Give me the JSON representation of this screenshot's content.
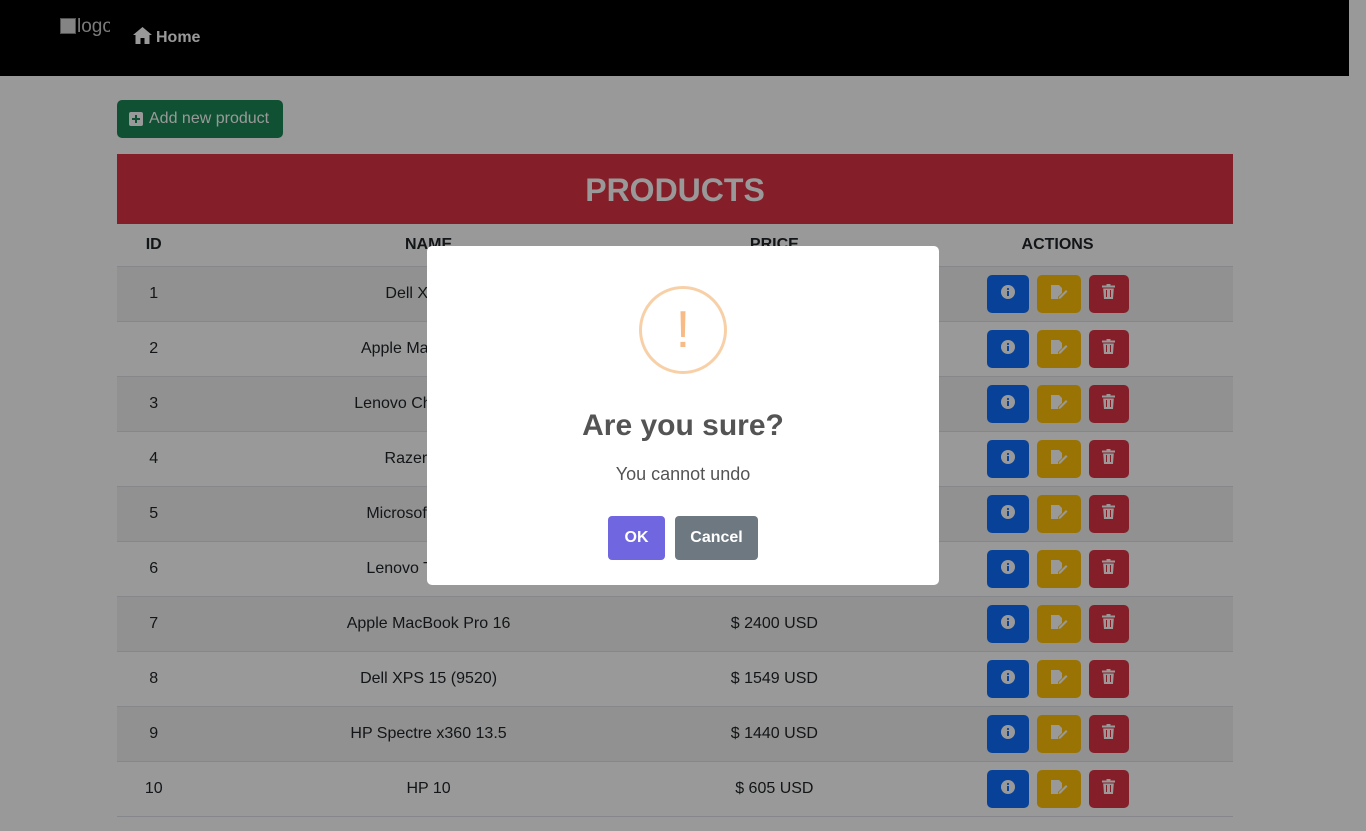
{
  "navbar": {
    "logo_alt": "logo",
    "home_label": "Home"
  },
  "toolbar": {
    "add_label": "Add new product"
  },
  "banner": {
    "title": "PRODUCTS"
  },
  "table": {
    "headers": {
      "id": "ID",
      "name": "NAME",
      "price": "PRICE",
      "actions": "ACTIONS"
    },
    "rows": [
      {
        "id": "1",
        "name": "Dell XPS 13",
        "price": ""
      },
      {
        "id": "2",
        "name": "Apple MacBook Air",
        "price": ""
      },
      {
        "id": "3",
        "name": "Lenovo Chromebook",
        "price": ""
      },
      {
        "id": "4",
        "name": "Razer Blade",
        "price": ""
      },
      {
        "id": "5",
        "name": "Microsoft Surface",
        "price": ""
      },
      {
        "id": "6",
        "name": "Lenovo ThinkPad",
        "price": ""
      },
      {
        "id": "7",
        "name": "Apple MacBook Pro 16",
        "price": "$ 2400 USD"
      },
      {
        "id": "8",
        "name": "Dell XPS 15 (9520)",
        "price": "$ 1549 USD"
      },
      {
        "id": "9",
        "name": "HP Spectre x360 13.5",
        "price": "$ 1440 USD"
      },
      {
        "id": "10",
        "name": "HP 10",
        "price": "$ 605 USD"
      }
    ],
    "row_actions": [
      "info-icon",
      "edit-icon",
      "trash-icon"
    ]
  },
  "dialog": {
    "icon": "!",
    "title": "Are you sure?",
    "text": "You cannot undo",
    "ok_label": "OK",
    "cancel_label": "Cancel"
  },
  "colors": {
    "navbar": "#000000",
    "add_button": "#198754",
    "banner": "#dc3545",
    "info": "#0d6efd",
    "edit": "#ffc107",
    "delete": "#dc3545",
    "ok": "#7066e0",
    "cancel": "#6e7881",
    "warning": "#f8bb86"
  }
}
